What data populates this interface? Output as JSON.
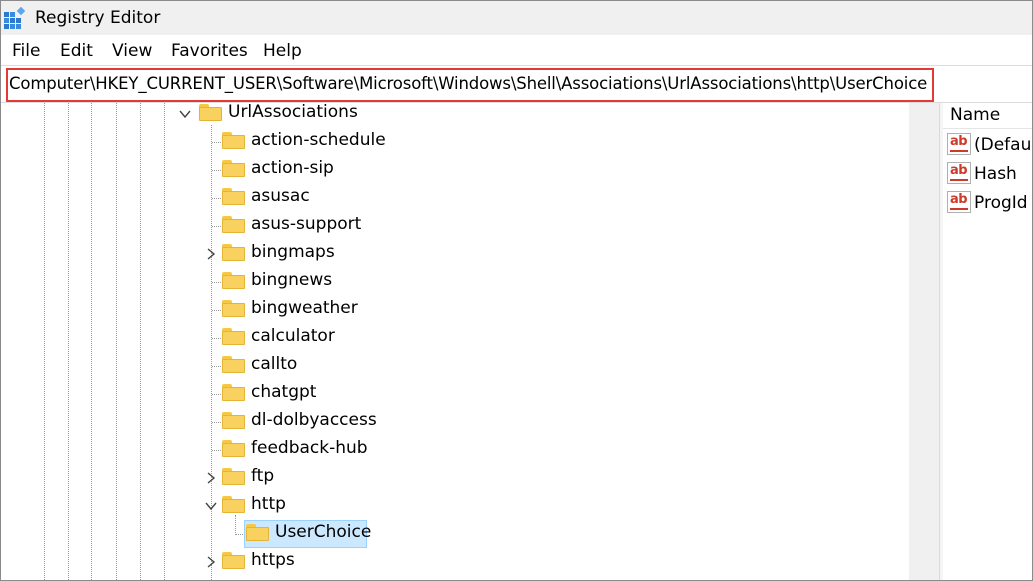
{
  "window": {
    "title": "Registry Editor"
  },
  "menu": [
    "File",
    "Edit",
    "View",
    "Favorites",
    "Help"
  ],
  "address": {
    "path": "Computer\\HKEY_CURRENT_USER\\Software\\Microsoft\\Windows\\Shell\\Associations\\UrlAssociations\\http\\UserChoice"
  },
  "tree": {
    "parent": {
      "label": "UrlAssociations",
      "expanded": true
    },
    "children": [
      {
        "label": "action-schedule",
        "expander": "none"
      },
      {
        "label": "action-sip",
        "expander": "none"
      },
      {
        "label": "asusac",
        "expander": "none"
      },
      {
        "label": "asus-support",
        "expander": "none"
      },
      {
        "label": "bingmaps",
        "expander": "collapsed"
      },
      {
        "label": "bingnews",
        "expander": "none"
      },
      {
        "label": "bingweather",
        "expander": "none"
      },
      {
        "label": "calculator",
        "expander": "none"
      },
      {
        "label": "callto",
        "expander": "none"
      },
      {
        "label": "chatgpt",
        "expander": "none"
      },
      {
        "label": "dl-dolbyaccess",
        "expander": "none"
      },
      {
        "label": "feedback-hub",
        "expander": "none"
      },
      {
        "label": "ftp",
        "expander": "collapsed"
      },
      {
        "label": "http",
        "expander": "expanded"
      },
      {
        "label": "https",
        "expander": "collapsed"
      }
    ],
    "selected": {
      "label": "UserChoice",
      "parent": "http"
    }
  },
  "values_pane": {
    "column_header": "Name",
    "rows": [
      {
        "name": "(Default)",
        "icon": "reg-sz-icon"
      },
      {
        "name": "Hash",
        "icon": "reg-sz-icon"
      },
      {
        "name": "ProgId",
        "icon": "reg-sz-icon"
      }
    ]
  },
  "colors": {
    "highlight_border": "#e53935",
    "selection_fill": "#cce8ff",
    "folder": "#f8d15f",
    "reg_sz_icon": "#cc3a2a"
  }
}
